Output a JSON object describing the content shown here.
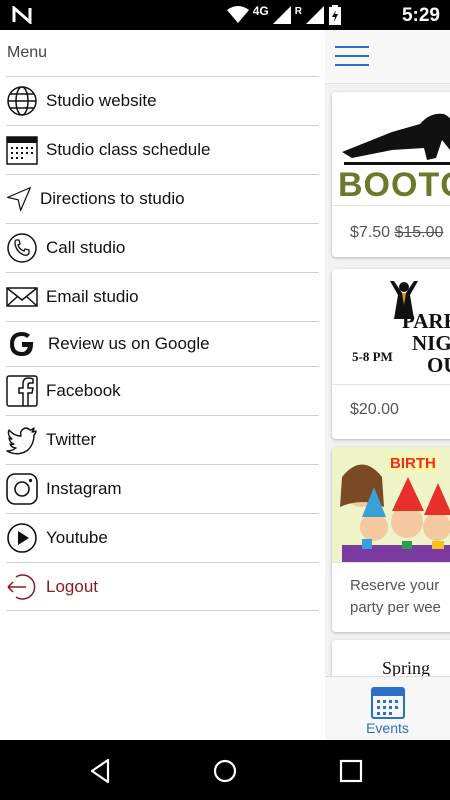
{
  "status_bar": {
    "network": "4G",
    "roaming": "R",
    "time": "5:29"
  },
  "drawer": {
    "title": "Menu",
    "items": [
      {
        "label": "Studio website",
        "icon": "globe-icon"
      },
      {
        "label": "Studio class schedule",
        "icon": "calendar-icon"
      },
      {
        "label": "Directions to studio",
        "icon": "navigation-arrow-icon"
      },
      {
        "label": "Call studio",
        "icon": "phone-icon"
      },
      {
        "label": "Email studio",
        "icon": "envelope-icon"
      },
      {
        "label": "Review us on Google",
        "icon": "google-icon"
      },
      {
        "label": "Facebook",
        "icon": "facebook-icon"
      },
      {
        "label": "Twitter",
        "icon": "twitter-icon"
      },
      {
        "label": "Instagram",
        "icon": "instagram-icon"
      },
      {
        "label": "Youtube",
        "icon": "youtube-play-icon"
      },
      {
        "label": "Logout",
        "icon": "logout-icon"
      }
    ]
  },
  "events": [
    {
      "image_text": "BOOTC",
      "price": "$7.50",
      "original_price": "$15.00"
    },
    {
      "image_text_line1": "PARE",
      "image_text_line2": "NIGH",
      "image_text_line3": "OU",
      "image_time": "5-8 PM",
      "price": "$20.00"
    },
    {
      "image_text": "BIRTH",
      "desc_line1": "Reserve your",
      "desc_line2": "party per wee"
    },
    {
      "image_text": "Spring"
    }
  ],
  "tab_bar": {
    "label": "Events"
  },
  "colors": {
    "accent": "#2c6fc6",
    "logout": "#8b1a1a",
    "bootcamp_green": "#6b7a2a"
  }
}
